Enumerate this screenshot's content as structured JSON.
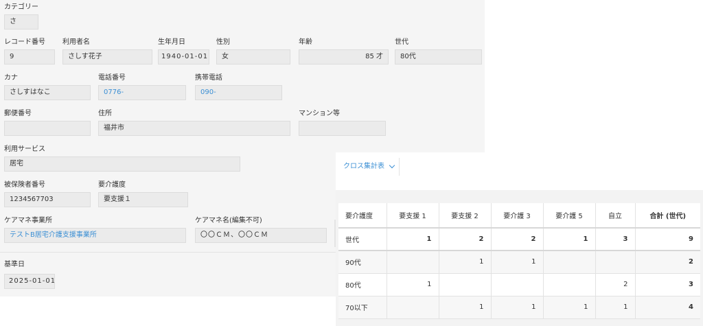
{
  "form": {
    "category": {
      "label": "カテゴリー",
      "value": "さ"
    },
    "record_no": {
      "label": "レコード番号",
      "value": "9"
    },
    "user_name": {
      "label": "利用者名",
      "value": "さしす花子"
    },
    "birthdate": {
      "label": "生年月日",
      "value": "1940-01-01"
    },
    "gender": {
      "label": "性別",
      "value": "女"
    },
    "age": {
      "label": "年齢",
      "value": "85 才"
    },
    "generation": {
      "label": "世代",
      "value": "80代"
    },
    "kana": {
      "label": "カナ",
      "value": "さしすはなこ"
    },
    "phone": {
      "label": "電話番号",
      "value": "0776-"
    },
    "mobile": {
      "label": "携帯電話",
      "value": "090-"
    },
    "postal": {
      "label": "郵便番号",
      "value": ""
    },
    "address": {
      "label": "住所",
      "value": "福井市"
    },
    "mansion": {
      "label": "マンション等",
      "value": ""
    },
    "service": {
      "label": "利用サービス",
      "value": "居宅"
    },
    "insured_no": {
      "label": "被保険者番号",
      "value": "1234567703"
    },
    "care_level": {
      "label": "要介護度",
      "value": "要支援１"
    },
    "care_office": {
      "label": "ケアマネ事業所",
      "value": "テストB居宅介護支援事業所"
    },
    "care_manager": {
      "label": "ケアマネ名(編集不可)",
      "value": "〇〇ＣＭ、〇〇ＣＭ"
    },
    "base_date": {
      "label": "基準日",
      "value": "2025-01-01"
    }
  },
  "crosstab": {
    "view_select": "クロス集計表",
    "headers": [
      "要介護度",
      "要支援 1",
      "要支援 2",
      "要介護 3",
      "要介護 5",
      "自立",
      "合計 (世代)"
    ],
    "rows": [
      {
        "label": "世代",
        "cells": [
          "1",
          "2",
          "2",
          "1",
          "3",
          "9"
        ]
      },
      {
        "label": "90代",
        "cells": [
          "",
          "1",
          "1",
          "",
          "",
          "2"
        ]
      },
      {
        "label": "80代",
        "cells": [
          "1",
          "",
          "",
          "",
          "2",
          "3"
        ]
      },
      {
        "label": "70以下",
        "cells": [
          "",
          "1",
          "1",
          "1",
          "1",
          "4"
        ]
      }
    ]
  },
  "colors": {
    "link": "#3b8fd4",
    "field_bg": "#ebebeb",
    "panel_bg": "#f5f5f5"
  }
}
